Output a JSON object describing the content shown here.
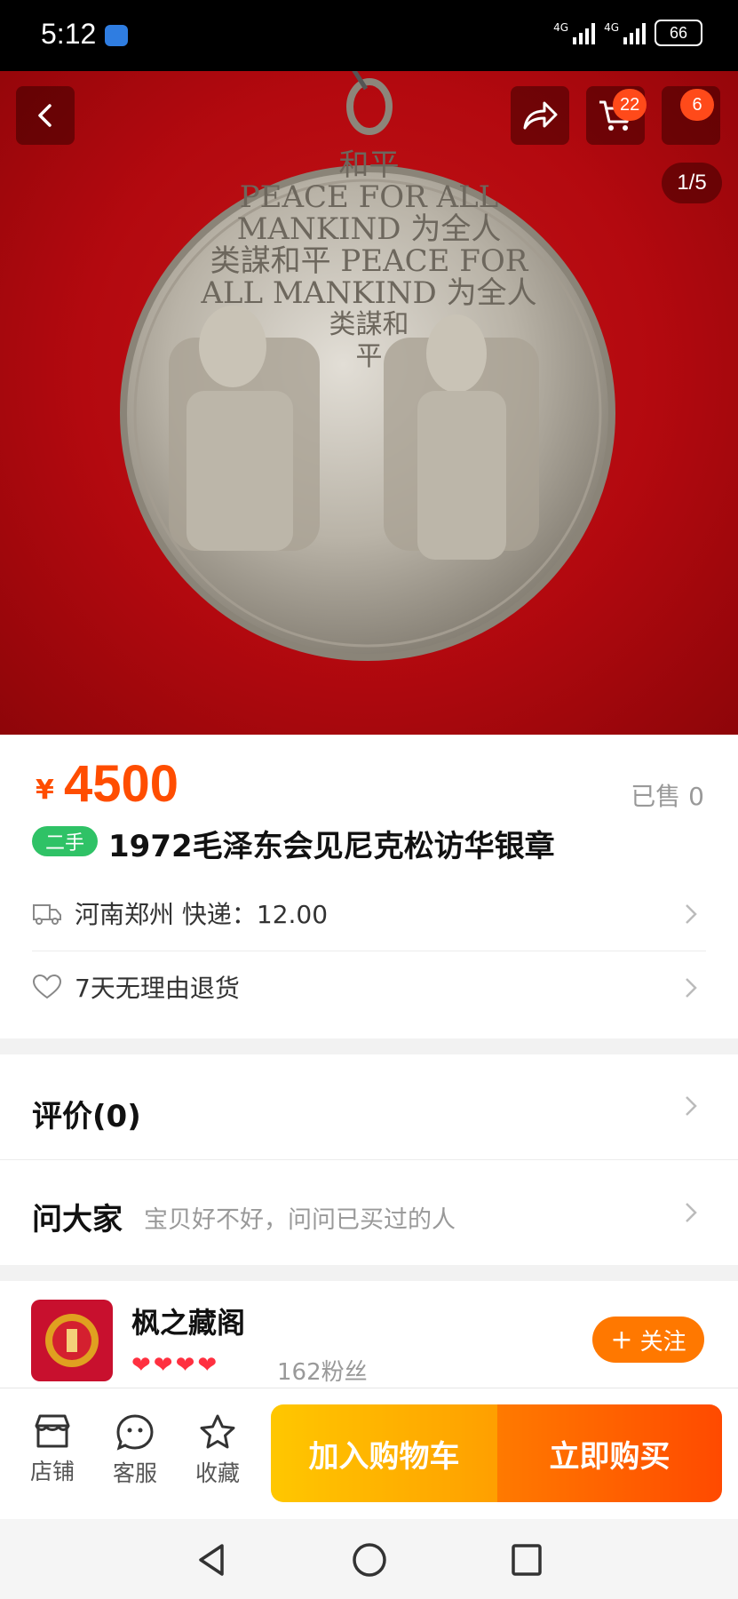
{
  "status_bar": {
    "time": "5:12",
    "network_1": "4G",
    "network_2": "4G",
    "battery": "66"
  },
  "hero": {
    "cart_badge": "22",
    "more_badge": "6",
    "pager": "1/5",
    "medal_text": {
      "line1": "和平",
      "line2": "PEACE FOR ALL",
      "line3": "MANKIND 为全人",
      "line4": "类謀和平 PEACE FOR",
      "line5": "ALL MANKIND 为全人",
      "line6": "类謀和",
      "line7": "平"
    }
  },
  "product": {
    "currency": "¥",
    "price": "4500",
    "sold": "已售 0",
    "tag": "二手",
    "title": "1972毛泽东会见尼克松访华银章",
    "shipping": "河南郑州  快递：12.00",
    "return_policy": "7天无理由退货"
  },
  "reviews": {
    "title": "评价(0)"
  },
  "ask": {
    "title": "问大家",
    "hint": "宝贝好不好，问问已买过的人"
  },
  "shop": {
    "name": "枫之藏阁",
    "fans": "162粉丝",
    "follow_label": "关注",
    "hearts": 4
  },
  "bottom_bar": {
    "store_label": "店铺",
    "service_label": "客服",
    "favorite_label": "收藏",
    "add_cart_label": "加入购物车",
    "buy_now_label": "立即购买"
  },
  "colors": {
    "accent": "#ff4d00",
    "hero_bg": "#b3090f",
    "tag_green": "#2fc266"
  }
}
